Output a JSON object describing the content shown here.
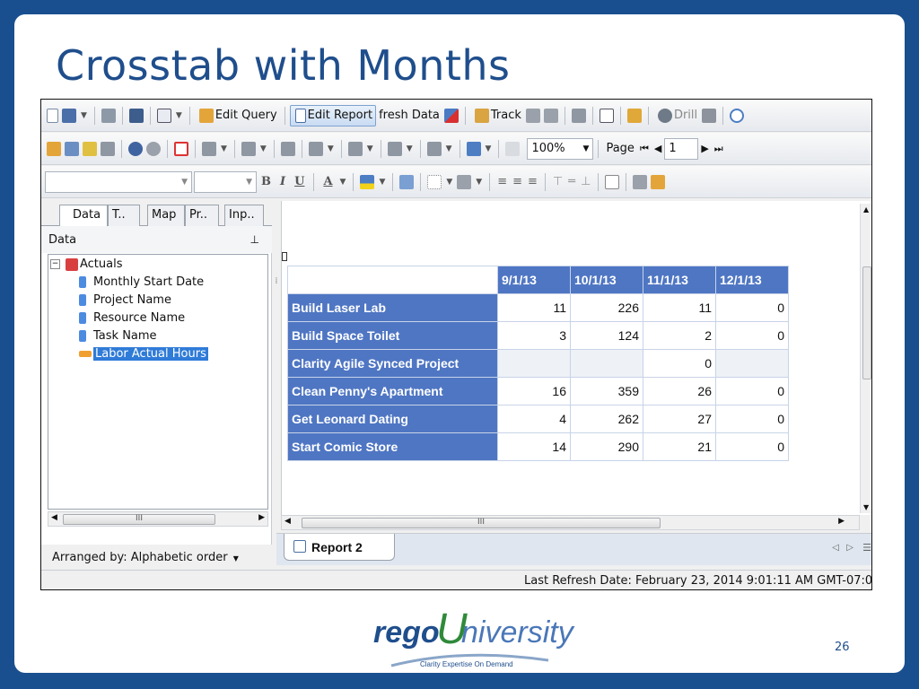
{
  "slide": {
    "title": "Crosstab with Months",
    "page_number": "26"
  },
  "toolbar1": {
    "edit_query": "Edit Query",
    "edit_report": "Edit Report",
    "refresh_data": "fresh Data",
    "track": "Track",
    "drill": "Drill"
  },
  "toolbar2": {
    "zoom": "100%",
    "page_label": "Page",
    "page_value": "1"
  },
  "left_panel": {
    "tabs": [
      "Data",
      "T..",
      "Map",
      "Pr..",
      "Inp.."
    ],
    "header": "Data",
    "tree_root": "Actuals",
    "tree_items": [
      "Monthly Start Date",
      "Project Name",
      "Resource Name",
      "Task Name",
      "Labor Actual Hours"
    ],
    "arranged_by": "Arranged by: Alphabetic order"
  },
  "crosstab": {
    "columns": [
      "9/1/13",
      "10/1/13",
      "11/1/13",
      "12/1/13"
    ],
    "rows": [
      {
        "label": "Build Laser Lab",
        "values": [
          "11",
          "226",
          "11",
          "0"
        ]
      },
      {
        "label": "Build Space Toilet",
        "values": [
          "3",
          "124",
          "2",
          "0"
        ]
      },
      {
        "label": "Clarity Agile Synced Project",
        "values": [
          "",
          "",
          "0",
          ""
        ]
      },
      {
        "label": "Clean Penny's Apartment",
        "values": [
          "16",
          "359",
          "26",
          "0"
        ]
      },
      {
        "label": "Get Leonard Dating",
        "values": [
          "4",
          "262",
          "27",
          "0"
        ]
      },
      {
        "label": "Start Comic Store",
        "values": [
          "14",
          "290",
          "21",
          "0"
        ]
      }
    ]
  },
  "report_tab": "Report 2",
  "status": "Last Refresh Date: February 23, 2014 9:01:11 AM GMT-07:0",
  "logo": {
    "brand_rego": "rego",
    "brand_u": "U",
    "brand_niversity": "niversity",
    "tagline": "Clarity Expertise On Demand"
  },
  "colors": {
    "slide_border": "#1a4f8f",
    "title": "#1f4e8c",
    "header_cell": "#4f76c3",
    "selection": "#2f7bd8"
  }
}
